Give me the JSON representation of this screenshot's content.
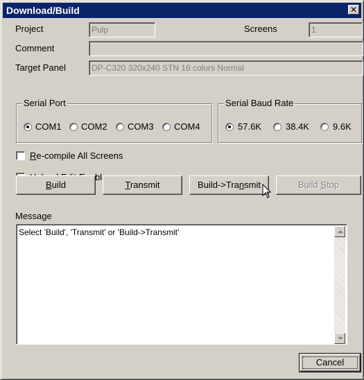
{
  "window": {
    "title": "Download/Build",
    "close_label": "✕"
  },
  "fields": {
    "project_label": "Project",
    "project_value": "Pulp",
    "screens_label": "Screens",
    "screens_value": "1",
    "comment_label": "Comment",
    "comment_value": "",
    "target_panel_label": "Target Panel",
    "target_panel_value": "DP-C320 320x240 STN 16 colors Normal"
  },
  "serial_port": {
    "title": "Serial Port",
    "options": [
      {
        "label": "COM1",
        "selected": true
      },
      {
        "label": "COM2",
        "selected": false
      },
      {
        "label": "COM3",
        "selected": false
      },
      {
        "label": "COM4",
        "selected": false
      }
    ]
  },
  "serial_baud": {
    "title": "Serial Baud Rate",
    "options": [
      {
        "label": "57.6K",
        "selected": true
      },
      {
        "label": "38.4K",
        "selected": false
      },
      {
        "label": "9.6K",
        "selected": false
      }
    ]
  },
  "checkboxes": {
    "recompile": {
      "label_key": "R",
      "label_rest": "e-compile All Screens",
      "checked": false
    },
    "upload_edit": {
      "label_key": "U",
      "label_rest": "pload Edit Enable",
      "checked": false
    }
  },
  "buttons": {
    "build": {
      "key": "B",
      "rest": "uild"
    },
    "transmit": {
      "key": "T",
      "rest": "ransmit"
    },
    "build_transmit": {
      "pre": "Build->Tra",
      "key": "n",
      "rest": "smit"
    },
    "build_stop": {
      "pre": "Build ",
      "key": "S",
      "rest": "top"
    },
    "cancel": "Cancel"
  },
  "message": {
    "label": "Message",
    "text": "Select 'Build', 'Transmit' or 'Build->Transmit'"
  },
  "colors": {
    "titlebar": "#0a246a",
    "face": "#d4d0c8",
    "disabled_text": "#808080"
  }
}
